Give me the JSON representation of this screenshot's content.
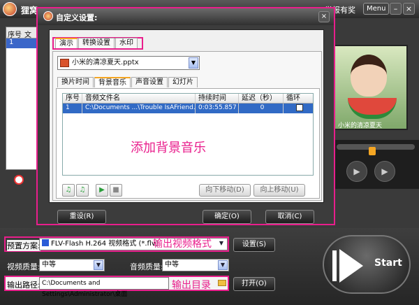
{
  "app": {
    "name": "狸窝...",
    "reward": "举报有奖",
    "menu_label": "Menu",
    "minimize": "–",
    "close": "×"
  },
  "file_list": {
    "headers": [
      "序号",
      "文"
    ],
    "rows": [
      {
        "index": "1"
      }
    ]
  },
  "preview": {
    "caption": "小米的清凉夏天"
  },
  "dialog": {
    "title": "自定义设置:",
    "close": "×",
    "tabs": [
      {
        "label": "演示",
        "active": true
      },
      {
        "label": "转换设置",
        "active": false
      },
      {
        "label": "水印",
        "active": false
      }
    ],
    "file_select": "小米的清凉夏天.pptx",
    "sub_tabs": [
      {
        "label": "换片时间",
        "active": false
      },
      {
        "label": "背景音乐",
        "active": true
      },
      {
        "label": "声音设置",
        "active": false
      },
      {
        "label": "幻灯片",
        "active": false
      }
    ],
    "grid": {
      "headers": [
        "序号",
        "音频文件名",
        "持续时间",
        "延迟（秒）",
        "循环"
      ],
      "rows": [
        {
          "index": "1",
          "file": "C:\\Documents ...\\Trouble IsAFriend.mp3",
          "duration": "0:03:55.857",
          "delay": "0",
          "loop": false
        }
      ]
    },
    "annotation": "添加背景音乐",
    "move_down": "向下移动(D)",
    "move_up": "向上移动(U)",
    "reset": "重设(R)",
    "ok": "确定(O)",
    "cancel": "取消(C)"
  },
  "bottom": {
    "preset_label": "预置方案:",
    "preset_value": "FLV-Flash H.264 视频格式 (*.flv)",
    "preset_annotation": "输出视频格式",
    "settings_button": "设置(S)",
    "video_quality_label": "视频质量:",
    "video_quality_value": "中等",
    "audio_quality_label": "音频质量:",
    "audio_quality_value": "中等",
    "output_label": "输出路径:",
    "output_value": "C:\\Documents and Settings\\Administrator\\桌面",
    "output_annotation": "输出目录",
    "open_button": "打开(O)",
    "start_label": "Start"
  },
  "colors": {
    "highlight": "#e91e8c",
    "selection": "#316ac5",
    "accent": "#f5a623"
  }
}
